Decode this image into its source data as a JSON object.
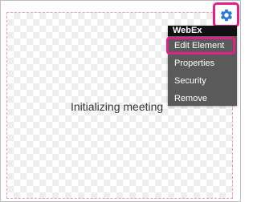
{
  "status_text": "Initializing meeting",
  "menu": {
    "title": "WebEx",
    "items": [
      {
        "label": "Edit Element",
        "highlighted": true
      },
      {
        "label": "Properties"
      },
      {
        "label": "Security"
      },
      {
        "label": "Remove"
      }
    ]
  },
  "colors": {
    "highlight": "#e0218a",
    "gear_icon": "#2b7bd6",
    "menu_bg": "#5a5a5a",
    "menu_title_bg": "#111111",
    "placeholder_border": "#e8a0b8"
  },
  "icons": {
    "settings": "gear-icon"
  }
}
